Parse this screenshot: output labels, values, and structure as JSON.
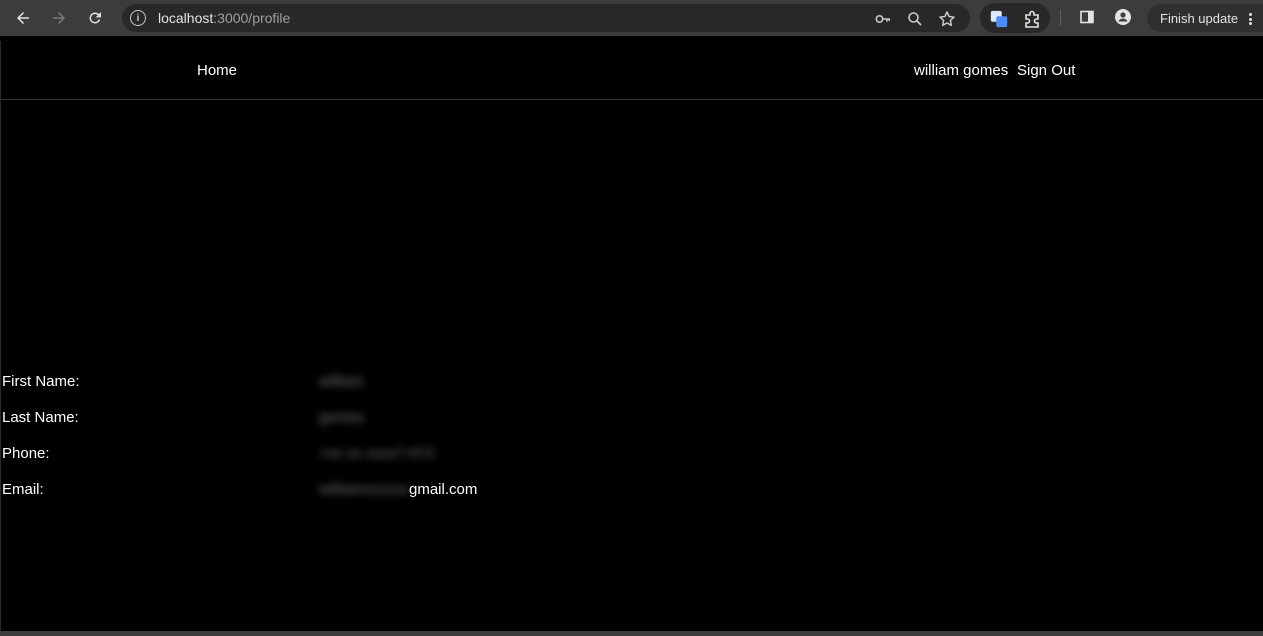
{
  "browser": {
    "url_host": "localhost",
    "url_path": ":3000/profile",
    "finish_update_label": "Finish update",
    "icons": {
      "back": "back-arrow-icon",
      "forward": "forward-arrow-icon",
      "reload": "reload-icon",
      "site_info": "info-icon",
      "passwords": "key-icon",
      "zoom": "zoom-icon",
      "bookmark": "star-icon",
      "extension_active": "extension-app-icon",
      "extensions": "puzzle-icon",
      "side_panel": "side-panel-icon",
      "profile": "profile-icon",
      "menu": "kebab-menu-icon"
    }
  },
  "navbar": {
    "home_label": "Home",
    "user_name": "william gomes",
    "sign_out_label": "Sign Out"
  },
  "profile": {
    "fields": [
      {
        "label": "First Name:",
        "value": "william"
      },
      {
        "label": "Last Name:",
        "value": "gomes"
      },
      {
        "label": "Phone:",
        "value": "+xx xx xxxx7-072"
      },
      {
        "label": "Email:",
        "value_hidden": "williamxxxxxx",
        "value_visible": "gmail.com"
      }
    ]
  },
  "colors": {
    "page_background": "#000000",
    "chrome_background": "#3c3c3c",
    "text": "#ffffff",
    "extension_accent": "#4d8cf5"
  }
}
